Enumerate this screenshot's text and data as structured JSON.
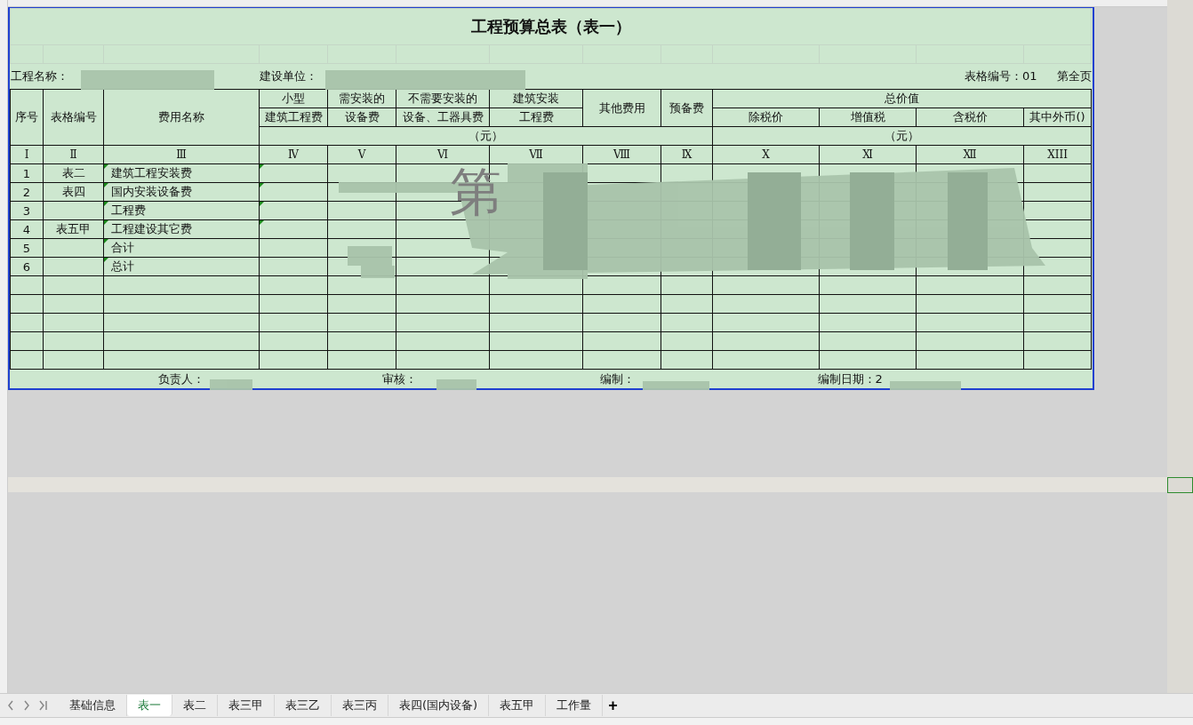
{
  "sheet": {
    "title": "工程预算总表（表一）",
    "info": {
      "project_label": "工程名称：",
      "unit_label": "建设单位：",
      "form_no": "表格编号：01",
      "page": "第全页"
    },
    "header_top": [
      "序号",
      "表格编号",
      "费用名称",
      "小型",
      "需安装的",
      "不需要安装的",
      "建筑安装",
      "其他费用",
      "预备费",
      "总价值"
    ],
    "header_sub": [
      "建筑工程费",
      "设备费",
      "设备、工器具费",
      "工程费",
      "除税价",
      "增值税",
      "含税价",
      "其中外币()"
    ],
    "unit_labels": [
      "（元）",
      "（元）"
    ],
    "roman": [
      "Ⅰ",
      "Ⅱ",
      "Ⅲ",
      "Ⅳ",
      "Ⅴ",
      "Ⅵ",
      "Ⅶ",
      "Ⅷ",
      "Ⅸ",
      "Ⅹ",
      "Ⅺ",
      "Ⅻ",
      "XIII"
    ],
    "rows": [
      {
        "no": "1",
        "form": "表二",
        "name": "建筑工程安装费",
        "name_flag": true,
        "col4_flag": true
      },
      {
        "no": "2",
        "form": "表四",
        "name": "国内安装设备费",
        "name_flag": true,
        "col4_flag": true
      },
      {
        "no": "3",
        "name": "工程费",
        "name_flag": true,
        "col4_flag": true
      },
      {
        "no": "4",
        "form": "表五甲",
        "name": "工程建设其它费",
        "name_flag": true,
        "col4_flag": true
      },
      {
        "no": "5",
        "name": "合计",
        "name_flag": true,
        "col4_flag": false
      },
      {
        "no": "6",
        "name": "总计",
        "name_flag": true,
        "col4_flag": false
      }
    ],
    "footer": [
      "负责人：",
      "审核：",
      "编制：",
      "编制日期：2"
    ],
    "page_mark": "第"
  },
  "tabs": [
    {
      "label": "基础信息",
      "selected": false
    },
    {
      "label": "表一",
      "selected": true
    },
    {
      "label": "表二",
      "selected": false
    },
    {
      "label": "表三甲",
      "selected": false
    },
    {
      "label": "表三乙",
      "selected": false
    },
    {
      "label": "表三丙",
      "selected": false
    },
    {
      "label": "表四(国内设备)",
      "selected": false
    },
    {
      "label": "表五甲",
      "selected": false
    },
    {
      "label": "工作量",
      "selected": false
    }
  ],
  "add_tab": "+"
}
